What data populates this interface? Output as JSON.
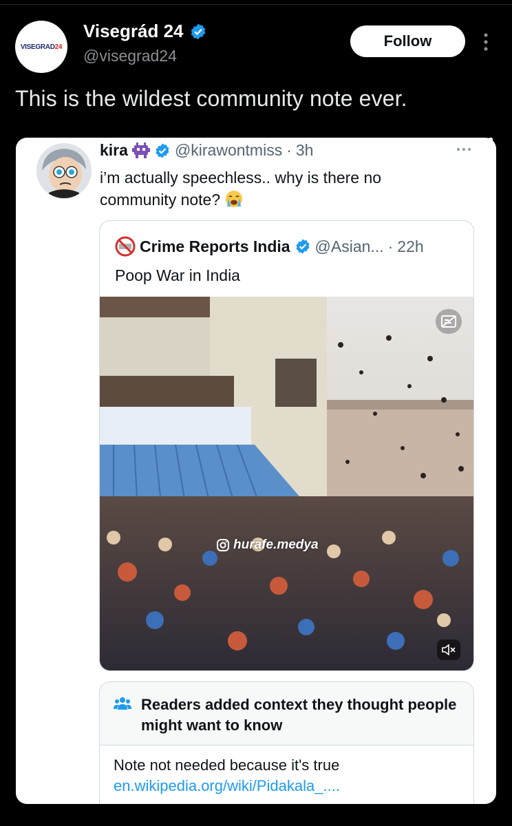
{
  "outer_post": {
    "author_name": "Visegrád 24",
    "author_handle": "@visegrad24",
    "avatar_logo": "VISEGRAD",
    "avatar_logo_accent": "24",
    "follow_label": "Follow",
    "text": "This is the wildest community note ever."
  },
  "inner_post": {
    "author_name": "kira",
    "author_handle": "@kirawontmiss",
    "time": "3h",
    "text": "i’m actually speechless.. why is there no community note?"
  },
  "quoted_post": {
    "author_name": "Crime Reports India",
    "author_handle": "@Asian...",
    "time": "22h",
    "text": "Poop War in India",
    "media_watermark": "hurafe.medya"
  },
  "community_note": {
    "title": "Readers added context they thought people might want to know",
    "body": "Note not needed because it's true",
    "link": "en.wikipedia.org/wiki/Pidakala_...."
  },
  "colors": {
    "accent_blue": "#1d9bf0",
    "background": "#000000",
    "secondary_text": "#536471"
  },
  "icons": [
    "verified-badge-icon",
    "more-options-icon",
    "alien-emoji-icon",
    "crying-emoji-icon",
    "no-crime-icon",
    "captions-icon",
    "mute-icon",
    "community-notes-icon",
    "instagram-icon"
  ]
}
